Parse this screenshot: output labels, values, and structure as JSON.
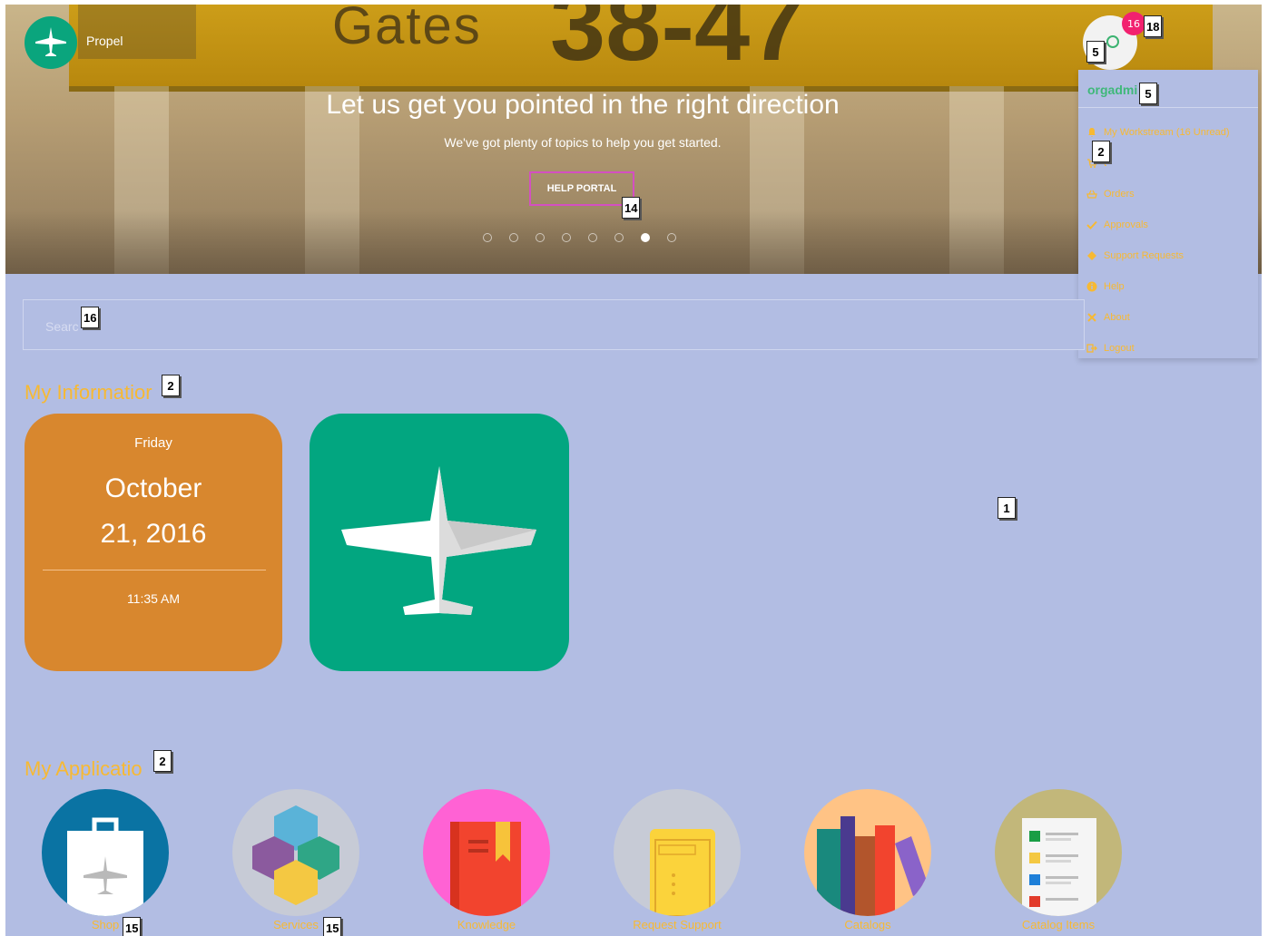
{
  "brand": {
    "name": "Propel"
  },
  "hero": {
    "sign_text": "Gates",
    "sign_number": "38-47",
    "title": "Let us get you pointed in the right direction",
    "subtitle": "We've got plenty of topics to help you get started.",
    "button_label": "HELP PORTAL",
    "slide_count": 8,
    "active_slide": 7
  },
  "user": {
    "notification_count": "16",
    "username": "orgadmi"
  },
  "user_menu": {
    "items": [
      {
        "label": "My Workstream (16 Unread)",
        "icon": "bell-icon"
      },
      {
        "label": "t",
        "icon": "cart-icon"
      },
      {
        "label": "Orders",
        "icon": "basket-icon"
      },
      {
        "label": "Approvals",
        "icon": "check-icon"
      },
      {
        "label": "Support Requests",
        "icon": "ticket-icon"
      },
      {
        "label": "Help",
        "icon": "info-icon"
      },
      {
        "label": "About",
        "icon": "plane-icon"
      },
      {
        "label": "Logout",
        "icon": "logout-icon"
      }
    ]
  },
  "search": {
    "placeholder": "Searc"
  },
  "my_information": {
    "title": "My Informatior",
    "date_card": {
      "day": "Friday",
      "month": "October",
      "date": "21, 2016",
      "time": "11:35 AM"
    }
  },
  "my_applications": {
    "title": "My Applicatio",
    "apps": [
      {
        "label": "Shop",
        "color": "#0a73a3",
        "icon": "shopping-bag-icon"
      },
      {
        "label": "Services",
        "color": "#c7cbd6",
        "icon": "cubes-icon"
      },
      {
        "label": "Knowledge",
        "color": "#ff62d4",
        "icon": "book-icon"
      },
      {
        "label": "Request Support",
        "color": "#c7cbd6",
        "icon": "support-ticket-icon"
      },
      {
        "label": "Catalogs",
        "color": "#ffc385",
        "icon": "books-icon"
      },
      {
        "label": "Catalog Items",
        "color": "#c2b77a",
        "icon": "list-document-icon"
      }
    ]
  },
  "markers": [
    "1",
    "2",
    "2",
    "2",
    "5",
    "5",
    "14",
    "15",
    "15",
    "16",
    "18"
  ],
  "colors": {
    "accent": "#f7b933",
    "brand_green": "#0aa57d",
    "date_card": "#d8872e",
    "plane_card": "#02a680",
    "badge": "#f2216f",
    "page_bg": "#b2bde3"
  }
}
